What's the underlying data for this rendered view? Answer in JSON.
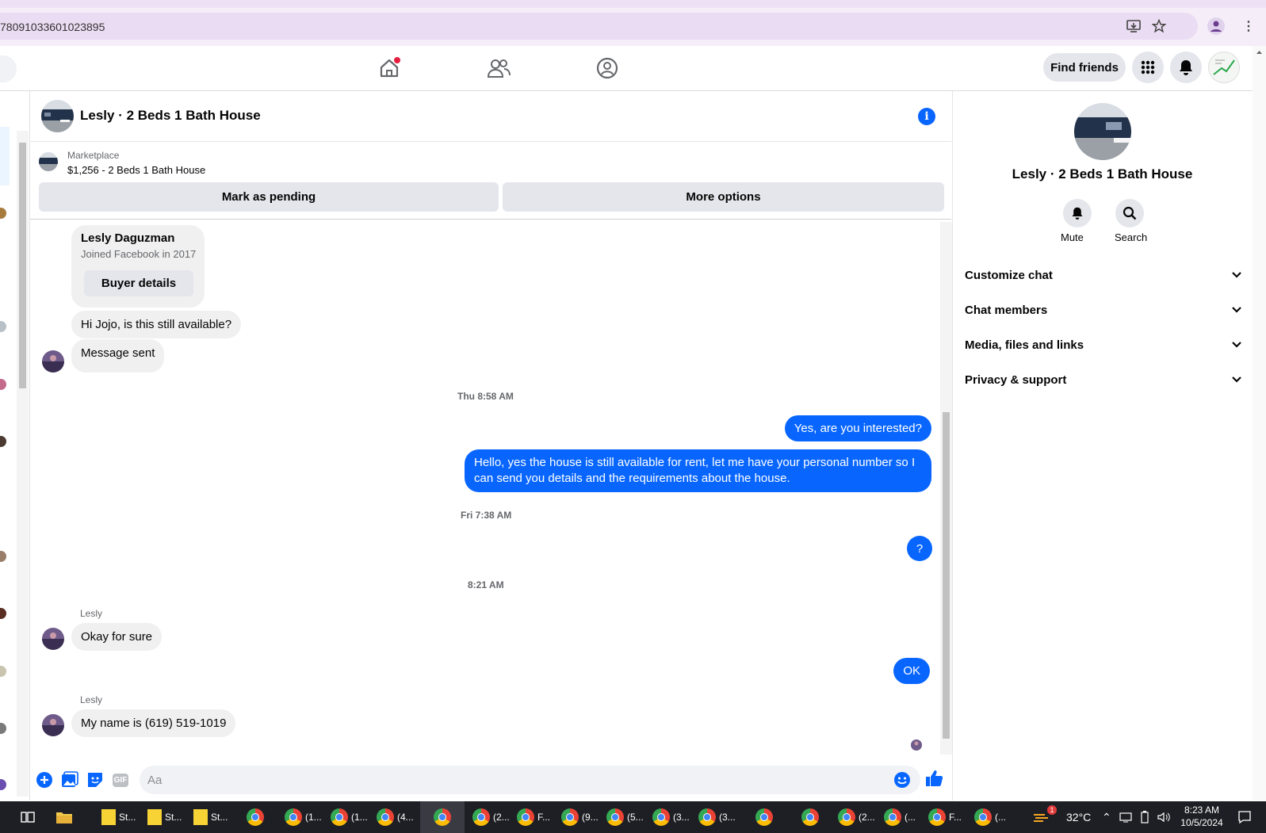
{
  "browser": {
    "url": "78091033601023895"
  },
  "header": {
    "find_friends": "Find friends"
  },
  "chat": {
    "title": "Lesly · 2 Beds 1 Bath House",
    "marketplace_label": "Marketplace",
    "listing": "$1,256 - 2 Beds 1 Bath House",
    "mark_pending": "Mark as pending",
    "more_options": "More options"
  },
  "buyer_card": {
    "name": "Lesly Daguzman",
    "joined": "Joined Facebook in 2017",
    "details_button": "Buyer details"
  },
  "messages": {
    "m1": "Hi Jojo, is this still available?",
    "m2": "Message sent",
    "ts1": "Thu 8:58 AM",
    "m3": "Yes, are you interested?",
    "m4_line1": "Hello, yes the house is still available for rent, let me have your personal number so I",
    "m4_line2": "can send you details and the requirements about the house.",
    "ts2": "Fri 7:38 AM",
    "m5": "?",
    "ts3": "8:21 AM",
    "sender1": "Lesly",
    "m6": "Okay for sure",
    "m7": "OK",
    "sender2": "Lesly",
    "m8": "My name is (619) 519-1019"
  },
  "composer": {
    "placeholder": "Aa",
    "gif_label": "GIF"
  },
  "right_panel": {
    "title": "Lesly · 2 Beds 1 Bath House",
    "mute_label": "Mute",
    "search_label": "Search",
    "sections": [
      "Customize chat",
      "Chat members",
      "Media, files and links",
      "Privacy & support"
    ]
  },
  "taskbar": {
    "items": [
      "St...",
      "St...",
      "St...",
      "(1...",
      "(1...",
      "(4...",
      "(2...",
      "F...",
      "(9...",
      "(5...",
      "(3...",
      "(3...",
      "(2...",
      "(...",
      "F...",
      "(..."
    ],
    "notification_count": "1",
    "temperature": "32°C",
    "time": "8:23 AM",
    "date": "10/5/2024"
  },
  "colors": {
    "accent": "#0866ff",
    "bubble_in": "#f0f0f0",
    "taskbar": "#1e1f24"
  }
}
